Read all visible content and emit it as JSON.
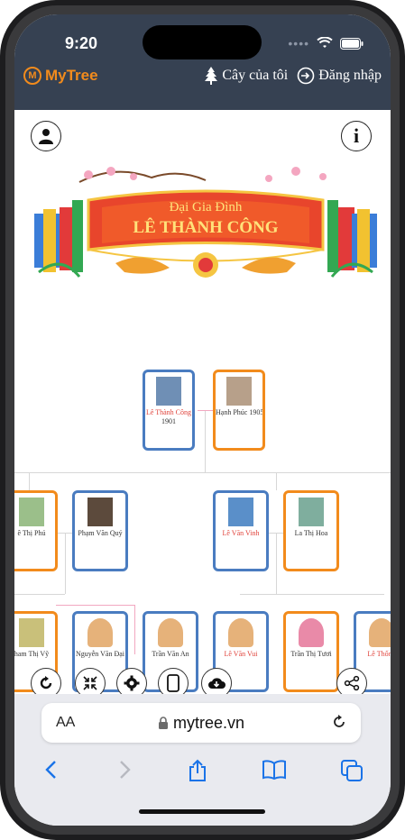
{
  "status_bar": {
    "time": "9:20",
    "dots": "••••"
  },
  "navbar": {
    "logo_letter": "M",
    "logo_text": "MyTree",
    "my_tree_label": "Cây của tôi",
    "login_label": "Đăng nhập"
  },
  "banner": {
    "line1": "Đại Gia Đình",
    "line2": "LÊ THÀNH CÔNG"
  },
  "tree": {
    "root": [
      {
        "name": "Lê Thành Công",
        "year": "1901",
        "gender": "male",
        "highlight": true
      },
      {
        "name": "Hạnh Phúc 1905",
        "year": "",
        "gender": "female",
        "highlight": false
      }
    ],
    "gen2": [
      {
        "name": "ê Thị Phú",
        "gender": "female",
        "highlight": false
      },
      {
        "name": "Phạm Văn Quý",
        "gender": "male",
        "highlight": false
      },
      {
        "name": "Lê Văn Vinh",
        "gender": "male",
        "highlight": true
      },
      {
        "name": "La Thị Hoa",
        "gender": "female",
        "highlight": false
      }
    ],
    "gen3": [
      {
        "name": "ham Thị Vỹ",
        "gender": "female",
        "highlight": false
      },
      {
        "name": "Nguyễn Văn Đại",
        "gender": "male",
        "highlight": false
      },
      {
        "name": "Trần Văn An",
        "gender": "male",
        "highlight": false
      },
      {
        "name": "Lê Văn Vui",
        "gender": "male",
        "highlight": true
      },
      {
        "name": "Trần Thị Tươi",
        "gender": "female",
        "highlight": false
      },
      {
        "name": "Lê Thống",
        "gender": "male",
        "highlight": true
      }
    ]
  },
  "toolbar": {
    "refresh": "refresh",
    "collapse": "collapse",
    "settings": "settings",
    "device": "device",
    "download": "download",
    "share": "share"
  },
  "safari": {
    "aa_label": "AA",
    "url": "mytree.vn"
  },
  "colors": {
    "header_bg": "#364152",
    "brand_orange": "#f28b1c",
    "male_border": "#4a7cc0",
    "female_border": "#f28b1c",
    "highlight_name": "#e0433b"
  }
}
